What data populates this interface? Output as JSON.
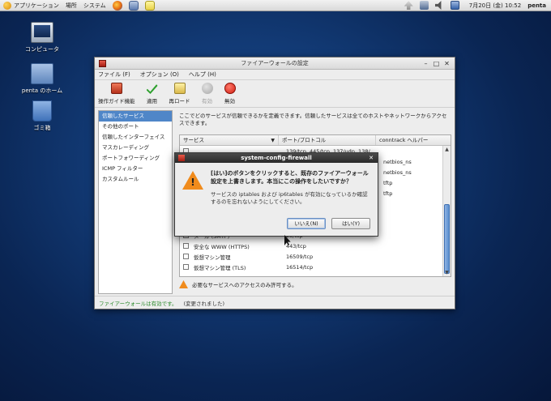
{
  "panel": {
    "applications": "アプリケーション",
    "places": "場所",
    "system": "システム",
    "launchers": [
      "firefox-icon",
      "mail-icon",
      "notes-icon"
    ],
    "clock": "7月20日 (金) 10:52",
    "user": "penta"
  },
  "desktop": {
    "icons": [
      {
        "label": "コンピュータ",
        "icon": "computer-icon"
      },
      {
        "label": "penta のホーム",
        "icon": "home-folder-icon"
      },
      {
        "label": "ゴミ箱",
        "icon": "trash-icon"
      }
    ]
  },
  "window": {
    "title": "ファイアーウォールの設定",
    "menu": [
      "ファイル (F)",
      "オプション (O)",
      "ヘルプ (H)"
    ],
    "toolbar": [
      {
        "label": "操作ガイド機能",
        "icon": "wizard-icon",
        "enabled": true
      },
      {
        "label": "適用",
        "icon": "apply-check-icon",
        "enabled": true
      },
      {
        "label": "再ロード",
        "icon": "reload-icon",
        "enabled": true
      },
      {
        "label": "有効",
        "icon": "enable-icon",
        "enabled": false
      },
      {
        "label": "無効",
        "icon": "disable-icon",
        "enabled": true
      }
    ],
    "sidebar": [
      "信頼したサービス",
      "その他のポート",
      "信頼したインターフェイス",
      "マスカレーディング",
      "ポートフォワーディング",
      "ICMP フィルター",
      "カスタムルール"
    ],
    "description": "ここでどのサービスが信頼できるかを定義できます。信頼したサービスは全てのホストやネットワークからアクセスできます。",
    "table": {
      "headers": [
        "サービス",
        "ポート/プロトコル",
        "conntrack ヘルパー"
      ],
      "rows": [
        {
          "name": "",
          "port": "139/tcp, 445/tcp, 137/udp, 138/",
          "helper": ""
        },
        {
          "name": "",
          "port": "",
          "helper": "netbios_ns"
        },
        {
          "name": "",
          "port": "",
          "helper": "netbios_ns"
        },
        {
          "name": "",
          "port": "",
          "helper": "tftp"
        },
        {
          "name": "",
          "port": "",
          "helper": "tftp"
        },
        {
          "name": "",
          "port": "",
          "helper": ""
        },
        {
          "name": "",
          "port": "",
          "helper": ""
        },
        {
          "name": "",
          "port": "",
          "helper": ""
        },
        {
          "name": "メール (SMTP)",
          "port": "25/tcp",
          "helper": ""
        },
        {
          "name": "安全な WWW (HTTPS)",
          "port": "443/tcp",
          "helper": ""
        },
        {
          "name": "仮想マシン管理",
          "port": "16509/tcp",
          "helper": ""
        },
        {
          "name": "仮想マシン管理 (TLS)",
          "port": "16514/tcp",
          "helper": ""
        }
      ]
    },
    "warning": "必要なサービスへのアクセスのみ許可する。",
    "status_enabled": "ファイアーウォールは有効です。",
    "status_changed": "(変更されました)"
  },
  "dialog": {
    "title": "system-config-firewall",
    "main": "[はい]のボタンをクリックすると、既存のファイアーウォール設定を上書きします。本当にこの操作をしたいですか？",
    "sub": "サービスの iptables および ip6tables が有効になっているか確認するのを忘れないようにしてください。",
    "no_button": "いいえ(N)",
    "yes_button": "はい(Y)"
  }
}
